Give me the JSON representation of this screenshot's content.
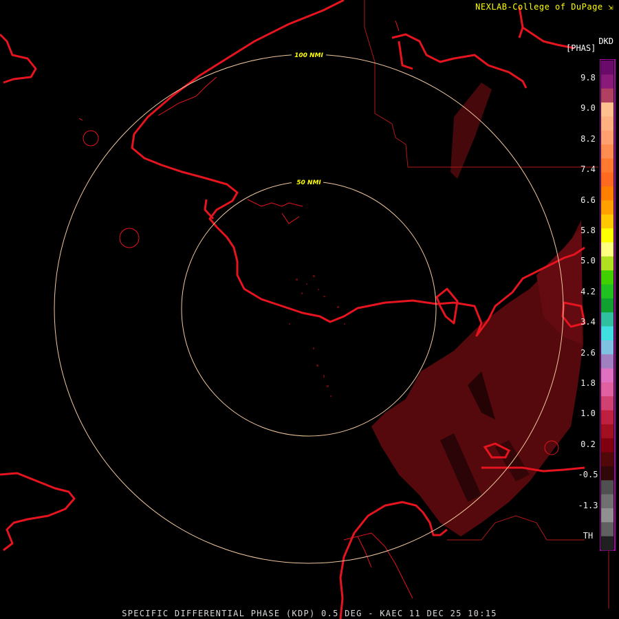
{
  "header": {
    "credit": "NEXLAB-College of DuPage",
    "product_code": "DKD",
    "units": "[PHAS]"
  },
  "footer": {
    "caption": "SPECIFIC DIFFERENTIAL PHASE (KDP) 0.5 DEG - KAEC 11 DEC 25 10:15"
  },
  "map": {
    "rings": [
      {
        "label": "50 NMI"
      },
      {
        "label": "100 NMI"
      }
    ],
    "colors": {
      "coastline": "#e6141e",
      "borders": "#b01818",
      "range_rings": "#f2c8a0",
      "echo": "#5a0a0e",
      "echo_light": "#7a1016"
    }
  },
  "legend": {
    "labels": [
      "9.8",
      "9.0",
      "8.2",
      "7.4",
      "6.6",
      "5.8",
      "5.0",
      "4.2",
      "3.4",
      "2.6",
      "1.8",
      "1.0",
      "0.2",
      "-0.5",
      "-1.3",
      "TH"
    ],
    "colors": [
      "#6a0a6a",
      "#8a1a7a",
      "#b04060",
      "#ffc090",
      "#ffb080",
      "#ffa070",
      "#ff8c50",
      "#ff7a30",
      "#ff6a20",
      "#ff8000",
      "#ffa000",
      "#ffc800",
      "#ffff00",
      "#ffff80",
      "#b0e020",
      "#40d000",
      "#20c020",
      "#10a030",
      "#30c0a0",
      "#40e0e0",
      "#80c0e0",
      "#a080c0",
      "#e070c0",
      "#e060a0",
      "#d04070",
      "#c02040",
      "#a01020",
      "#800010",
      "#500808",
      "#300808",
      "#505050",
      "#707070",
      "#909090",
      "#606060",
      "#202020"
    ]
  }
}
